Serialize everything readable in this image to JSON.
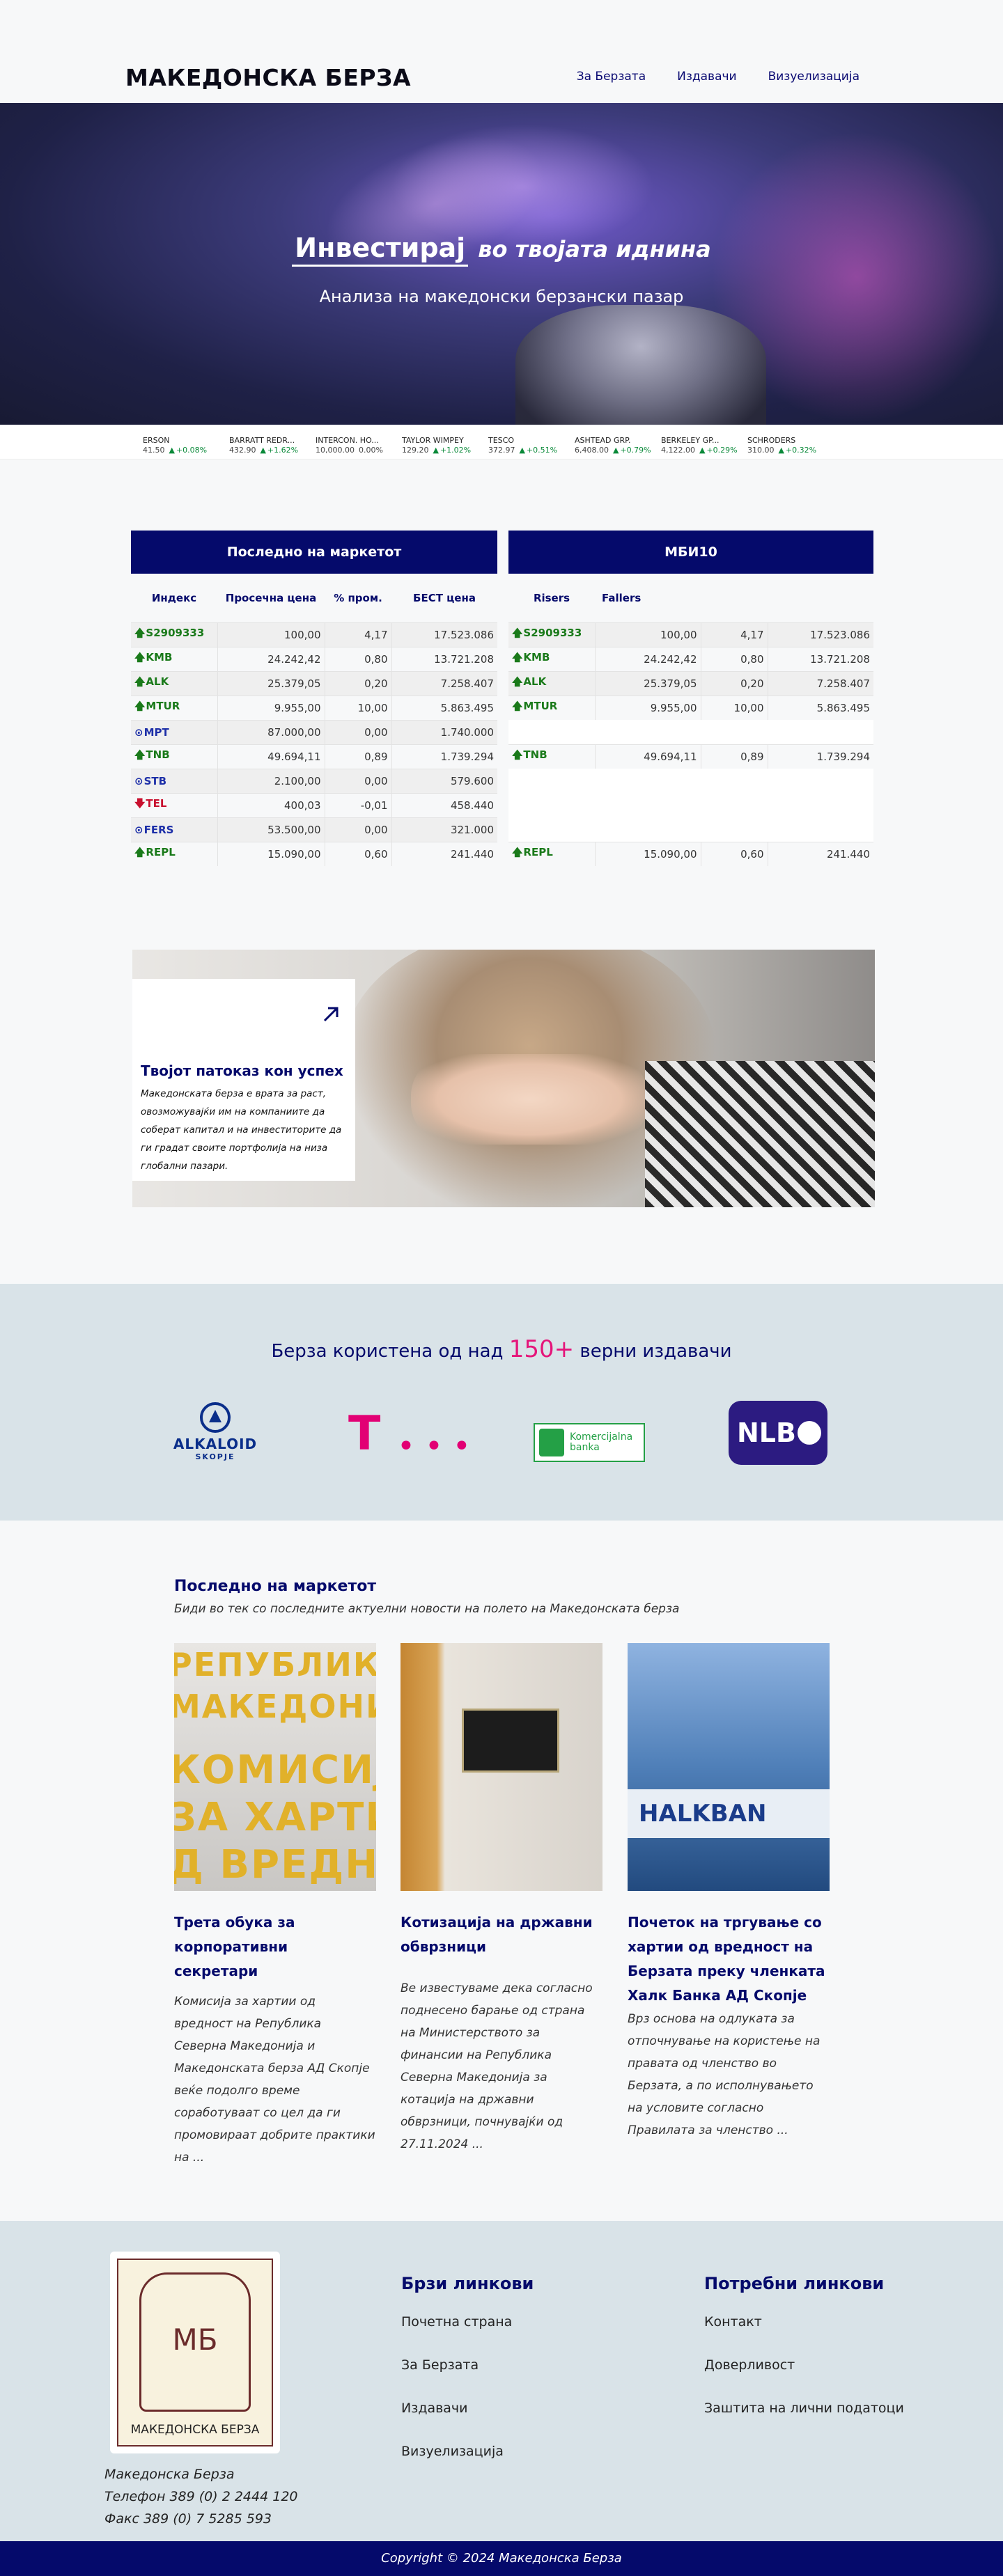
{
  "header": {
    "brand": "МАКЕДОНСКА БЕРЗА",
    "nav": [
      "За Берзата",
      "Издавачи",
      "Визуелизација"
    ]
  },
  "hero": {
    "title_main": "Инвестирај",
    "title_rest": "во твојата иднина",
    "subtitle": "Анализа на македонски берзански пазар"
  },
  "ticker": [
    {
      "name": "ERSON",
      "price": "41.50",
      "change": "+0.08%"
    },
    {
      "name": "BARRATT REDR...",
      "price": "432.90",
      "change": "+1.62%"
    },
    {
      "name": "INTERCON. HO...",
      "price": "10,000.00",
      "change": "0.00%"
    },
    {
      "name": "TAYLOR WIMPEY",
      "price": "129.20",
      "change": "+1.02%"
    },
    {
      "name": "TESCO",
      "price": "372.97",
      "change": "+0.51%"
    },
    {
      "name": "ASHTEAD GRP.",
      "price": "6,408.00",
      "change": "+0.79%"
    },
    {
      "name": "BERKELEY GP...",
      "price": "4,122.00",
      "change": "+0.29%"
    },
    {
      "name": "SCHRODERS",
      "price": "310.00",
      "change": "+0.32%"
    }
  ],
  "market": {
    "title": "Последно на маркетот",
    "headers": [
      "Индекс",
      "Просечна цена",
      "% пром.",
      "БЕСТ цена"
    ],
    "rows": [
      {
        "sym": "S2909333",
        "dir": "up",
        "avg": "100,00",
        "pct": "4,17",
        "best": "17.523.086"
      },
      {
        "sym": "KMB",
        "dir": "up",
        "avg": "24.242,42",
        "pct": "0,80",
        "best": "13.721.208"
      },
      {
        "sym": "ALK",
        "dir": "up",
        "avg": "25.379,05",
        "pct": "0,20",
        "best": "7.258.407"
      },
      {
        "sym": "MTUR",
        "dir": "up",
        "avg": "9.955,00",
        "pct": "10,00",
        "best": "5.863.495"
      },
      {
        "sym": "MPT",
        "dir": "neutral",
        "avg": "87.000,00",
        "pct": "0,00",
        "best": "1.740.000"
      },
      {
        "sym": "TNB",
        "dir": "up",
        "avg": "49.694,11",
        "pct": "0,89",
        "best": "1.739.294"
      },
      {
        "sym": "STB",
        "dir": "neutral",
        "avg": "2.100,00",
        "pct": "0,00",
        "best": "579.600"
      },
      {
        "sym": "TEL",
        "dir": "down",
        "avg": "400,03",
        "pct": "-0,01",
        "best": "458.440"
      },
      {
        "sym": "FERS",
        "dir": "neutral",
        "avg": "53.500,00",
        "pct": "0,00",
        "best": "321.000"
      },
      {
        "sym": "REPL",
        "dir": "up",
        "avg": "15.090,00",
        "pct": "0,60",
        "best": "241.440"
      }
    ]
  },
  "mbi10": {
    "title": "МБИ10",
    "tabs": [
      "Risers",
      "Fallers"
    ],
    "rows": [
      {
        "sym": "S2909333",
        "dir": "up",
        "avg": "100,00",
        "pct": "4,17",
        "best": "17.523.086"
      },
      {
        "sym": "KMB",
        "dir": "up",
        "avg": "24.242,42",
        "pct": "0,80",
        "best": "13.721.208"
      },
      {
        "sym": "ALK",
        "dir": "up",
        "avg": "25.379,05",
        "pct": "0,20",
        "best": "7.258.407"
      },
      {
        "sym": "MTUR",
        "dir": "up",
        "avg": "9.955,00",
        "pct": "10,00",
        "best": "5.863.495"
      },
      {
        "sym": "",
        "dir": "",
        "avg": "",
        "pct": "",
        "best": ""
      },
      {
        "sym": "TNB",
        "dir": "up",
        "avg": "49.694,11",
        "pct": "0,89",
        "best": "1.739.294"
      },
      {
        "sym": "",
        "dir": "",
        "avg": "",
        "pct": "",
        "best": ""
      },
      {
        "sym": "",
        "dir": "",
        "avg": "",
        "pct": "",
        "best": ""
      },
      {
        "sym": "",
        "dir": "",
        "avg": "",
        "pct": "",
        "best": ""
      },
      {
        "sym": "REPL",
        "dir": "up",
        "avg": "15.090,00",
        "pct": "0,60",
        "best": "241.440"
      }
    ]
  },
  "promo": {
    "title": "Твојот патоказ кон успех",
    "text": "Македонската берза е врата за раст, овозможувајќи им на компаниите да соберат капитал и на инвеститорите да ги градат своите портфолија на низа глобални пазари."
  },
  "publishers": {
    "heading_before": "Берза користена од над",
    "count": "150+",
    "heading_after": "верни издавачи",
    "logos": {
      "alkaloid": "ALKALOID",
      "alkaloid_sub": "SKOPJE",
      "telekom": "T",
      "komercijalna_1": "Komercijalna",
      "komercijalna_2": "banka",
      "nlb": "NLB"
    }
  },
  "news": {
    "title": "Последно на маркетот",
    "subtitle": "Биди во тек со последните актуелни новости на полето на Македонската берза",
    "image1_lines": [
      "РЕПУБЛИКА",
      "МАКЕДОНИЈ",
      "КОМИСИЈ",
      "ЗА ХАРТИ",
      "Д ВРЕДНО"
    ],
    "image3_text": "HALKBAN",
    "items": [
      {
        "title": "Трета обука за корпоративни секретари",
        "text": "Комисија за хартии од вредност на Република Северна Македонија и Македонската берза АД Скопје веќе подолго време соработуваат со цел да ги промовираат добрите практики на ..."
      },
      {
        "title": "Котизација на државни обврзници",
        "text": "Ве известуваме дека согласно поднесено барање од страна на Министерството за финансии на Република Северна Македонија за котација на државни обврзници, почнувајќи од 27.11.2024 ..."
      },
      {
        "title": "Почеток на тргување со хартии од вредност на Берзата преку членката Халк Банка АД Скопје",
        "text": "Врз основа на одлуката за отпочнување на користење на правата од членство во Берзата, а по исполнувањето на условите согласно Правилата за членство ..."
      }
    ]
  },
  "footer": {
    "seal_letters": "МБ",
    "seal_caption": "МАКЕДОНСКА БЕРЗА",
    "company": "Македонска Берза",
    "phone": "Телефон 389 (0) 2 2444 120",
    "fax": "Факс 389 (0) 7 5285 593",
    "quick_title": "Брзи линкови",
    "quick_links": [
      "Почетна страна",
      "За Берзата",
      "Издавачи",
      "Визуелизација"
    ],
    "needed_title": "Потребни линкови",
    "needed_links": [
      "Контакт",
      "Доверливост",
      "Заштита на лични податоци"
    ],
    "copyright": "Copyright © 2024 Македонска Берза"
  },
  "colors": {
    "navy": "#050a6b",
    "pink": "#e5157a",
    "up": "#1a7a1a",
    "down": "#c8102e"
  }
}
